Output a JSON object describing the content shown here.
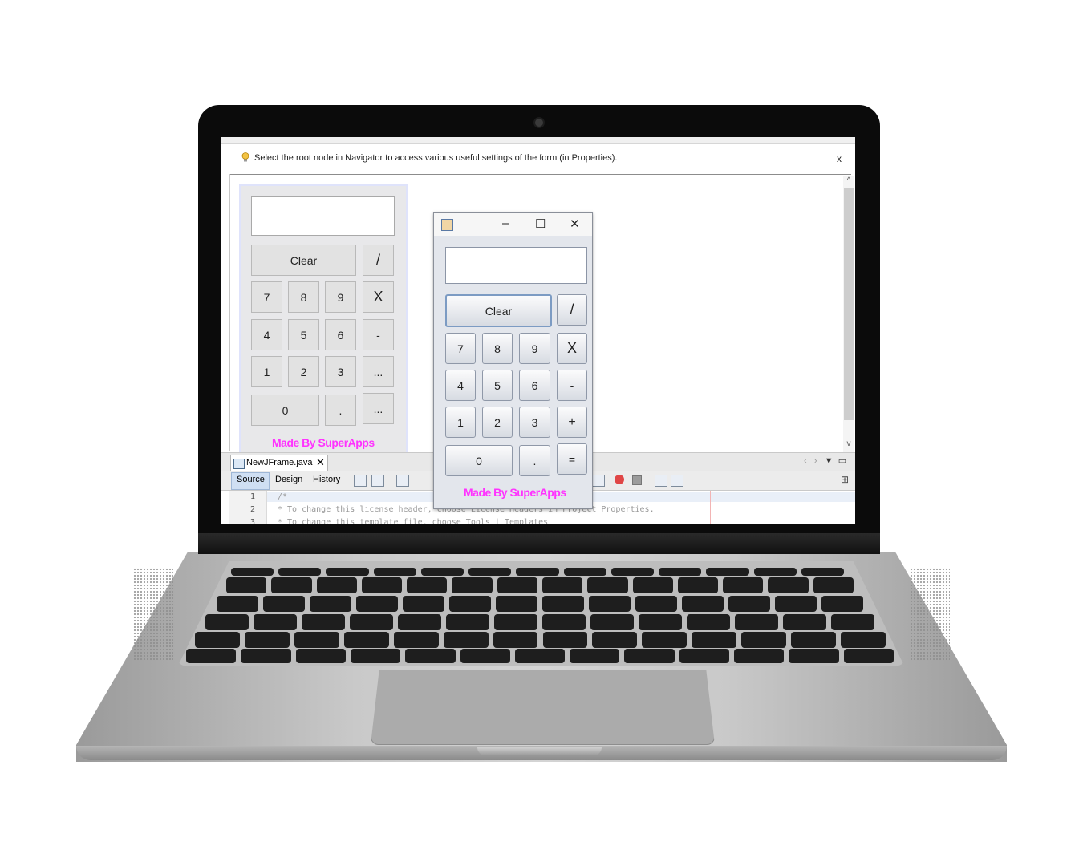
{
  "hint": {
    "text": "Select the root node in Navigator to access various useful settings of the form (in Properties).",
    "close": "x"
  },
  "design_calc": {
    "clear": "Clear",
    "buttons": [
      "/",
      "7",
      "8",
      "9",
      "X",
      "4",
      "5",
      "6",
      "-",
      "1",
      "2",
      "3",
      "...",
      "0",
      ".",
      "..."
    ],
    "brand": "Made By SuperApps"
  },
  "run_window": {
    "minimize": "–",
    "maximize": "☐",
    "close": "✕",
    "clear": "Clear",
    "buttons": [
      "/",
      "7",
      "8",
      "9",
      "X",
      "4",
      "5",
      "6",
      "-",
      "1",
      "2",
      "3",
      "+",
      "0",
      ".",
      "="
    ],
    "brand": "Made By SuperApps"
  },
  "editor": {
    "file_tab": "NewJFrame.java",
    "file_tab_close": "✕",
    "views": [
      "Source",
      "Design",
      "History"
    ],
    "line_numbers": [
      "1",
      "2",
      "3"
    ],
    "code_lines": [
      "/*",
      " * To change this license header, choose License Headers in Project Properties.",
      " * To change this template file, choose Tools | Templates"
    ]
  },
  "colors": {
    "brand": "#ff33ff",
    "bezel": "#0b0b0b",
    "aluminum": "#c9c9c9"
  }
}
